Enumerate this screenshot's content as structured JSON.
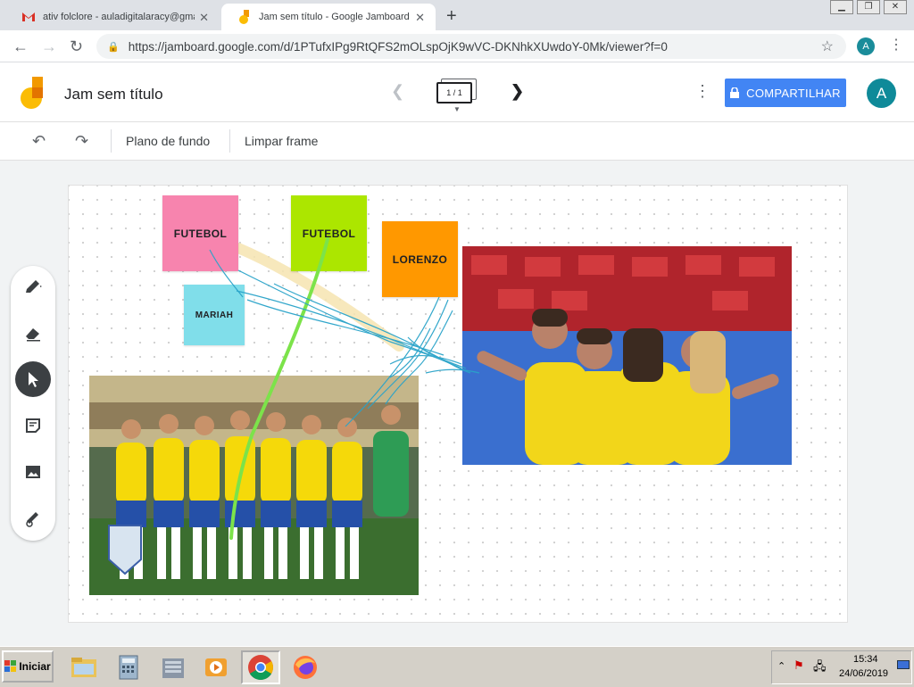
{
  "browser": {
    "tabs": [
      {
        "label": "ativ folclore - auladigitalaracy@gmail",
        "icon": "gmail-icon",
        "active": false
      },
      {
        "label": "Jam sem título - Google Jamboard",
        "icon": "jamboard-icon",
        "active": true
      }
    ],
    "url": "https://jamboard.google.com/d/1PTufxIPg9RtQFS2mOLspOjK9wVC-DKNhkXUwdoY-0Mk/viewer?f=0",
    "profile_initial": "A"
  },
  "jamboard": {
    "title": "Jam sem título",
    "frame_indicator": "1 / 1",
    "share_label": "COMPARTILHAR",
    "avatar_initial": "A",
    "toolbar": {
      "background_label": "Plano de fundo",
      "clear_label": "Limpar frame"
    },
    "tools": [
      "pen-tool",
      "eraser-tool",
      "select-tool",
      "sticky-note-tool",
      "image-tool",
      "laser-tool"
    ],
    "active_tool": "select-tool"
  },
  "canvas": {
    "notes": [
      {
        "text": "FUTEBOL",
        "color": "#f784ae"
      },
      {
        "text": "FUTEBOL",
        "color": "#ace600"
      },
      {
        "text": "LORENZO",
        "color": "#ff9800"
      },
      {
        "text": "MARIAH",
        "color": "#80deea"
      }
    ],
    "images": [
      "men-national-team-photo",
      "women-team-celebration-photo"
    ]
  },
  "taskbar": {
    "start_label": "Iniciar",
    "time": "15:34",
    "date": "24/06/2019"
  },
  "colors": {
    "accent": "#4285f4",
    "avatar": "#0f8a99"
  }
}
